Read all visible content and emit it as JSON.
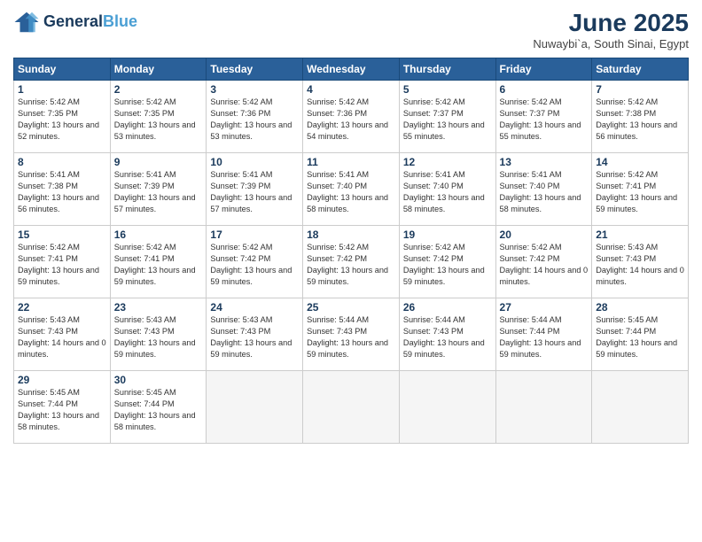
{
  "header": {
    "logo_line1": "General",
    "logo_line2": "Blue",
    "month_title": "June 2025",
    "location": "Nuwaybi`a, South Sinai, Egypt"
  },
  "weekdays": [
    "Sunday",
    "Monday",
    "Tuesday",
    "Wednesday",
    "Thursday",
    "Friday",
    "Saturday"
  ],
  "days": [
    {
      "date": 1,
      "col": 0,
      "sunrise": "5:42 AM",
      "sunset": "7:35 PM",
      "daylight": "13 hours and 52 minutes."
    },
    {
      "date": 2,
      "col": 1,
      "sunrise": "5:42 AM",
      "sunset": "7:35 PM",
      "daylight": "13 hours and 53 minutes."
    },
    {
      "date": 3,
      "col": 2,
      "sunrise": "5:42 AM",
      "sunset": "7:36 PM",
      "daylight": "13 hours and 53 minutes."
    },
    {
      "date": 4,
      "col": 3,
      "sunrise": "5:42 AM",
      "sunset": "7:36 PM",
      "daylight": "13 hours and 54 minutes."
    },
    {
      "date": 5,
      "col": 4,
      "sunrise": "5:42 AM",
      "sunset": "7:37 PM",
      "daylight": "13 hours and 55 minutes."
    },
    {
      "date": 6,
      "col": 5,
      "sunrise": "5:42 AM",
      "sunset": "7:37 PM",
      "daylight": "13 hours and 55 minutes."
    },
    {
      "date": 7,
      "col": 6,
      "sunrise": "5:42 AM",
      "sunset": "7:38 PM",
      "daylight": "13 hours and 56 minutes."
    },
    {
      "date": 8,
      "col": 0,
      "sunrise": "5:41 AM",
      "sunset": "7:38 PM",
      "daylight": "13 hours and 56 minutes."
    },
    {
      "date": 9,
      "col": 1,
      "sunrise": "5:41 AM",
      "sunset": "7:39 PM",
      "daylight": "13 hours and 57 minutes."
    },
    {
      "date": 10,
      "col": 2,
      "sunrise": "5:41 AM",
      "sunset": "7:39 PM",
      "daylight": "13 hours and 57 minutes."
    },
    {
      "date": 11,
      "col": 3,
      "sunrise": "5:41 AM",
      "sunset": "7:40 PM",
      "daylight": "13 hours and 58 minutes."
    },
    {
      "date": 12,
      "col": 4,
      "sunrise": "5:41 AM",
      "sunset": "7:40 PM",
      "daylight": "13 hours and 58 minutes."
    },
    {
      "date": 13,
      "col": 5,
      "sunrise": "5:41 AM",
      "sunset": "7:40 PM",
      "daylight": "13 hours and 58 minutes."
    },
    {
      "date": 14,
      "col": 6,
      "sunrise": "5:42 AM",
      "sunset": "7:41 PM",
      "daylight": "13 hours and 59 minutes."
    },
    {
      "date": 15,
      "col": 0,
      "sunrise": "5:42 AM",
      "sunset": "7:41 PM",
      "daylight": "13 hours and 59 minutes."
    },
    {
      "date": 16,
      "col": 1,
      "sunrise": "5:42 AM",
      "sunset": "7:41 PM",
      "daylight": "13 hours and 59 minutes."
    },
    {
      "date": 17,
      "col": 2,
      "sunrise": "5:42 AM",
      "sunset": "7:42 PM",
      "daylight": "13 hours and 59 minutes."
    },
    {
      "date": 18,
      "col": 3,
      "sunrise": "5:42 AM",
      "sunset": "7:42 PM",
      "daylight": "13 hours and 59 minutes."
    },
    {
      "date": 19,
      "col": 4,
      "sunrise": "5:42 AM",
      "sunset": "7:42 PM",
      "daylight": "13 hours and 59 minutes."
    },
    {
      "date": 20,
      "col": 5,
      "sunrise": "5:42 AM",
      "sunset": "7:42 PM",
      "daylight": "14 hours and 0 minutes."
    },
    {
      "date": 21,
      "col": 6,
      "sunrise": "5:43 AM",
      "sunset": "7:43 PM",
      "daylight": "14 hours and 0 minutes."
    },
    {
      "date": 22,
      "col": 0,
      "sunrise": "5:43 AM",
      "sunset": "7:43 PM",
      "daylight": "14 hours and 0 minutes."
    },
    {
      "date": 23,
      "col": 1,
      "sunrise": "5:43 AM",
      "sunset": "7:43 PM",
      "daylight": "13 hours and 59 minutes."
    },
    {
      "date": 24,
      "col": 2,
      "sunrise": "5:43 AM",
      "sunset": "7:43 PM",
      "daylight": "13 hours and 59 minutes."
    },
    {
      "date": 25,
      "col": 3,
      "sunrise": "5:44 AM",
      "sunset": "7:43 PM",
      "daylight": "13 hours and 59 minutes."
    },
    {
      "date": 26,
      "col": 4,
      "sunrise": "5:44 AM",
      "sunset": "7:43 PM",
      "daylight": "13 hours and 59 minutes."
    },
    {
      "date": 27,
      "col": 5,
      "sunrise": "5:44 AM",
      "sunset": "7:44 PM",
      "daylight": "13 hours and 59 minutes."
    },
    {
      "date": 28,
      "col": 6,
      "sunrise": "5:45 AM",
      "sunset": "7:44 PM",
      "daylight": "13 hours and 59 minutes."
    },
    {
      "date": 29,
      "col": 0,
      "sunrise": "5:45 AM",
      "sunset": "7:44 PM",
      "daylight": "13 hours and 58 minutes."
    },
    {
      "date": 30,
      "col": 1,
      "sunrise": "5:45 AM",
      "sunset": "7:44 PM",
      "daylight": "13 hours and 58 minutes."
    }
  ]
}
